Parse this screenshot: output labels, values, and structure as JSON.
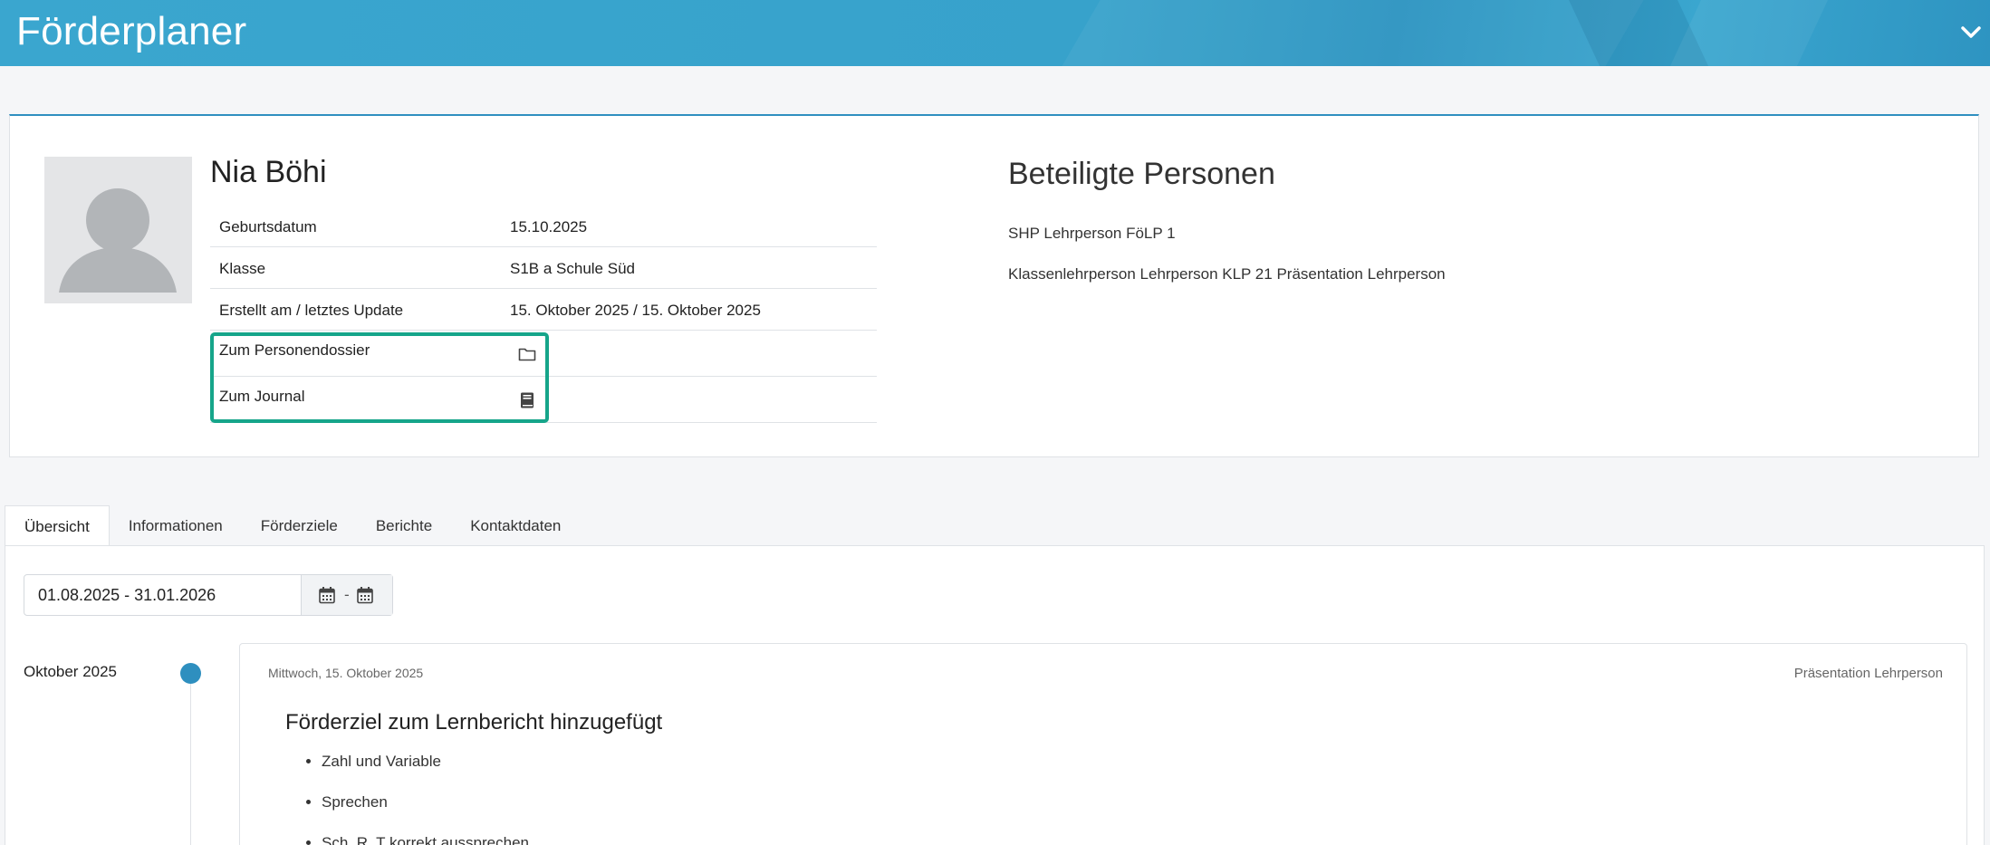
{
  "header": {
    "title": "Förderplaner",
    "chevron_icon": "chevron-down-icon"
  },
  "profile": {
    "name": "Nia Böhi",
    "avatar_icon": "user-avatar-placeholder",
    "rows": [
      {
        "label": "Geburtsdatum",
        "value": "15.10.2025"
      },
      {
        "label": "Klasse",
        "value": "S1B a Schule Süd"
      },
      {
        "label": "Erstellt am / letztes Update",
        "value": "15. Oktober 2025 / 15. Oktober 2025"
      }
    ],
    "links": [
      {
        "label": "Zum Personendossier",
        "icon": "folder-icon"
      },
      {
        "label": "Zum Journal",
        "icon": "book-icon"
      }
    ],
    "highlight_color": "#16a58a"
  },
  "parties": {
    "title": "Beteiligte Personen",
    "items": [
      "SHP Lehrperson FöLP 1",
      "Klassenlehrperson Lehrperson KLP 21 Präsentation Lehrperson"
    ]
  },
  "tabs": [
    {
      "label": "Übersicht",
      "active": true
    },
    {
      "label": "Informationen",
      "active": false
    },
    {
      "label": "Förderziele",
      "active": false
    },
    {
      "label": "Berichte",
      "active": false
    },
    {
      "label": "Kontaktdaten",
      "active": false
    }
  ],
  "daterange": {
    "value": "01.08.2025 - 31.01.2026",
    "separator": "-",
    "icons": [
      "calendar-icon",
      "calendar-icon"
    ]
  },
  "timeline": {
    "month": "Oktober 2025",
    "dot_color": "#2e8fbf",
    "entry": {
      "date": "Mittwoch, 15. Oktober 2025",
      "author": "Präsentation Lehrperson",
      "heading": "Förderziel zum Lernbericht hinzugefügt",
      "items": [
        "Zahl und Variable",
        "Sprechen",
        "Sch, R, T korrekt aussprechen"
      ]
    }
  },
  "colors": {
    "header": "#3aa6cf",
    "accent": "#2f8fc0"
  }
}
